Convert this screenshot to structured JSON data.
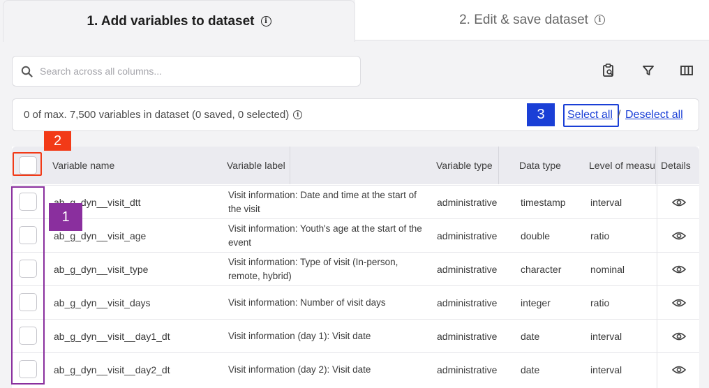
{
  "tabs": [
    {
      "label": "1. Add variables to dataset"
    },
    {
      "label": "2. Edit & save dataset"
    }
  ],
  "search": {
    "placeholder": "Search across all columns..."
  },
  "toolbar": {
    "icons": [
      "clipboard-search-icon",
      "filter-icon",
      "columns-icon"
    ]
  },
  "infobar": {
    "count_text": "0 of max. 7,500 variables in dataset (0 saved, 0 selected)",
    "select_all": "Select all",
    "slash": "/",
    "deselect_all": "Deselect all"
  },
  "annotations": {
    "one": "1",
    "two": "2",
    "three": "3"
  },
  "colors": {
    "accent_blue": "#1a3fd6",
    "annot_red": "#f23a17",
    "annot_purple": "#8a2f9e"
  },
  "table": {
    "headers": {
      "name": "Variable name",
      "label": "Variable label",
      "type": "Variable type",
      "data": "Data type",
      "level": "Level of measurement",
      "details": "Details"
    },
    "rows": [
      {
        "name": "ab_g_dyn__visit_dtt",
        "label": "Visit information: Date and time at the start of the visit",
        "type": "administrative",
        "data": "timestamp",
        "level": "interval"
      },
      {
        "name": "ab_g_dyn__visit_age",
        "label": "Visit information: Youth's age at the start of the event",
        "type": "administrative",
        "data": "double",
        "level": "ratio"
      },
      {
        "name": "ab_g_dyn__visit_type",
        "label": "Visit information: Type of visit (In-person, remote, hybrid)",
        "type": "administrative",
        "data": "character",
        "level": "nominal"
      },
      {
        "name": "ab_g_dyn__visit_days",
        "label": "Visit information: Number of visit days",
        "type": "administrative",
        "data": "integer",
        "level": "ratio"
      },
      {
        "name": "ab_g_dyn__visit__day1_dt",
        "label": "Visit information (day 1): Visit date",
        "type": "administrative",
        "data": "date",
        "level": "interval"
      },
      {
        "name": "ab_g_dyn__visit__day2_dt",
        "label": "Visit information (day 2): Visit date",
        "type": "administrative",
        "data": "date",
        "level": "interval"
      }
    ]
  }
}
